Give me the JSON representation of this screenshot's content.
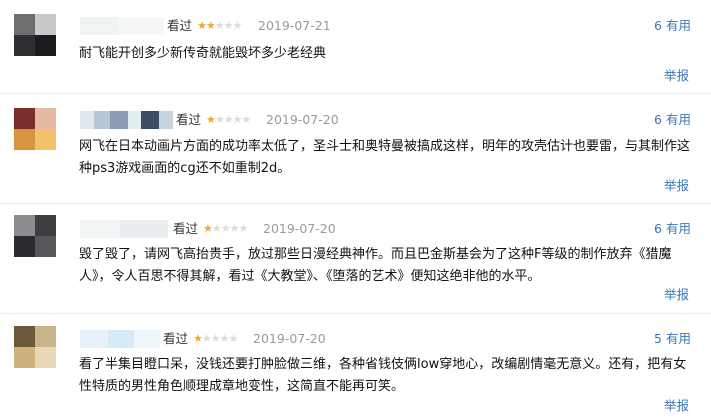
{
  "reviews": [
    {
      "status": "看过",
      "rating": 2,
      "date": "2019-07-21",
      "vote_count": "6",
      "vote_label": "有用",
      "text": "耐飞能开创多少新传奇就能毁坏多少老经典",
      "report": "举报",
      "avatar_colors": [
        "#6e6e70",
        "#c9c9cb",
        "#2e2f33",
        "#1b1c1f"
      ],
      "name_colors": [
        "#eef3f4",
        "#f6f8f8"
      ]
    },
    {
      "status": "看过",
      "rating": 1,
      "date": "2019-07-20",
      "vote_count": "6",
      "vote_label": "有用",
      "text": "网飞在日本动画片方面的成功率太低了，圣斗士和奥特曼被搞成这样，明年的攻壳估计也要雷，与其制作这种ps3游戏画面的cg还不如重制2d。",
      "report": "举报",
      "avatar_colors": [
        "#7a2d2a",
        "#e6b9a5",
        "#d9943f",
        "#f2c16b"
      ],
      "name_colors": [
        "#dfe9ee",
        "#b8c8d6",
        "#8a9bb3",
        "#e3eef2",
        "#3c4c63",
        "#c5d4df"
      ]
    },
    {
      "status": "看过",
      "rating": 1,
      "date": "2019-07-20",
      "vote_count": "6",
      "vote_label": "有用",
      "text": "毁了毁了，请网飞高抬贵手，放过那些日漫经典神作。而且巴金斯基会为了这种F等级的制作放弃《猎魔人》，令人百思不得其解，看过《大教堂》、《堕落的艺术》便知这绝非他的水平。",
      "report": "举报",
      "avatar_colors": [
        "#8d8d8f",
        "#3d3e42",
        "#2a2b2e",
        "#56575b"
      ],
      "name_colors": [
        "#f2f6f7",
        "#e9eef0"
      ]
    },
    {
      "status": "看过",
      "rating": 1,
      "date": "2019-07-20",
      "vote_count": "5",
      "vote_label": "有用",
      "text": "看了半集目瞪口呆，没钱还要打肿脸做三维，各种省钱伎俩low穿地心，改编剧情毫无意义。还有，把有女性特质的男性角色顺理成章地变性，这简直不能再可笑。",
      "report": "举报",
      "avatar_colors": [
        "#6b5a3a",
        "#c8b489",
        "#cdb27c",
        "#e8d8b8"
      ],
      "name_colors": [
        "#e6f2f8",
        "#d6ebf5",
        "#eef6fa"
      ]
    }
  ]
}
